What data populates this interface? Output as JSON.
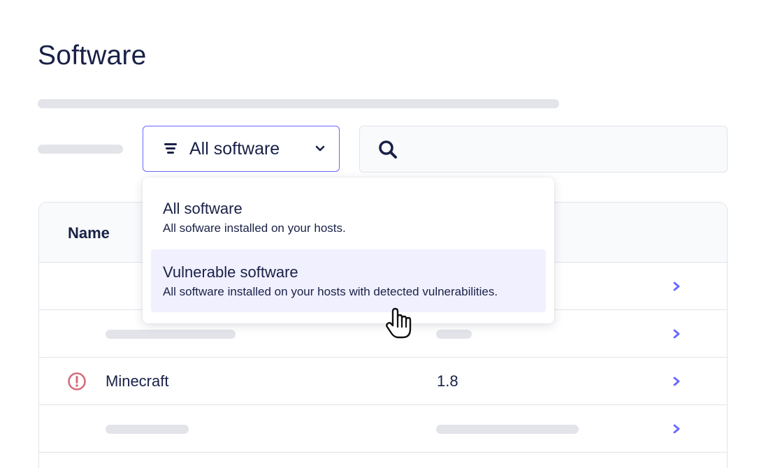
{
  "page": {
    "title": "Software"
  },
  "filter": {
    "selected": "All software"
  },
  "search": {
    "value": "",
    "placeholder": ""
  },
  "table": {
    "columns": [
      "Name"
    ],
    "rows": [
      {
        "name": "",
        "version": ""
      },
      {
        "name": "",
        "version": ""
      },
      {
        "name": "Minecraft",
        "version": "1.8",
        "vulnerable": true
      },
      {
        "name": "",
        "version": ""
      }
    ]
  },
  "menu": {
    "items": [
      {
        "title": "All software",
        "description": "All sofware installed on your hosts."
      },
      {
        "title": "Vulnerable software",
        "description": "All software installed on your hosts with detected vulnerabilities.",
        "highlighted": true
      }
    ]
  },
  "colors": {
    "accent": "#6a67fe",
    "text": "#192147",
    "danger": "#d66c7b",
    "skeleton": "#e2e4ea",
    "highlight": "#f1f0ff"
  },
  "icons": [
    "filter-icon",
    "chevron-down-icon",
    "search-icon",
    "alert-icon",
    "chevron-right-icon",
    "hand-pointer-icon"
  ]
}
